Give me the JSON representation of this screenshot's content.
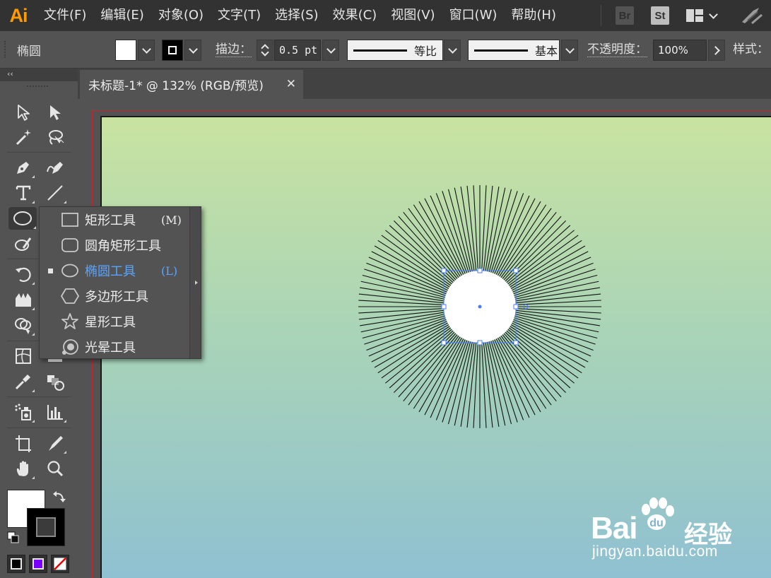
{
  "app": {
    "logo": "Ai"
  },
  "menu": {
    "items": [
      "文件(F)",
      "编辑(E)",
      "对象(O)",
      "文字(T)",
      "选择(S)",
      "效果(C)",
      "视图(V)",
      "窗口(W)",
      "帮助(H)"
    ],
    "badges": {
      "bridge": "Br",
      "stock": "St"
    }
  },
  "control_bar": {
    "object_type": "椭圆",
    "stroke_label": "描边：",
    "stroke_weight": "0.5 pt",
    "profile_width": "等比",
    "brush_definition": "基本",
    "opacity_label": "不透明度：",
    "opacity_value": "100%",
    "style_label": "样式："
  },
  "document": {
    "tab_title": "未标题-1* @ 132% (RGB/预览)",
    "close_glyph": "✕"
  },
  "flyout": {
    "items": [
      {
        "label": "矩形工具",
        "shortcut": "(M)",
        "icon": "rectangle-icon",
        "selected": false
      },
      {
        "label": "圆角矩形工具",
        "shortcut": "",
        "icon": "rounded-rectangle-icon",
        "selected": false
      },
      {
        "label": "椭圆工具",
        "shortcut": "(L)",
        "icon": "ellipse-icon",
        "selected": true
      },
      {
        "label": "多边形工具",
        "shortcut": "",
        "icon": "polygon-icon",
        "selected": false
      },
      {
        "label": "星形工具",
        "shortcut": "",
        "icon": "star-icon",
        "selected": false
      },
      {
        "label": "光晕工具",
        "shortcut": "",
        "icon": "flare-icon",
        "selected": false
      }
    ]
  },
  "watermark": {
    "brand": "Bai",
    "jingyan": "经验",
    "url": "jingyan.baidu.com"
  },
  "colors": {
    "menubar": "#323232",
    "panel": "#535353",
    "ai_orange": "#ff9a00",
    "selection_blue": "#5aa4ff",
    "artboard_top": "#c9e3a1",
    "artboard_bottom": "#8dbfd3",
    "artboard_bleed": "#c1272d"
  }
}
